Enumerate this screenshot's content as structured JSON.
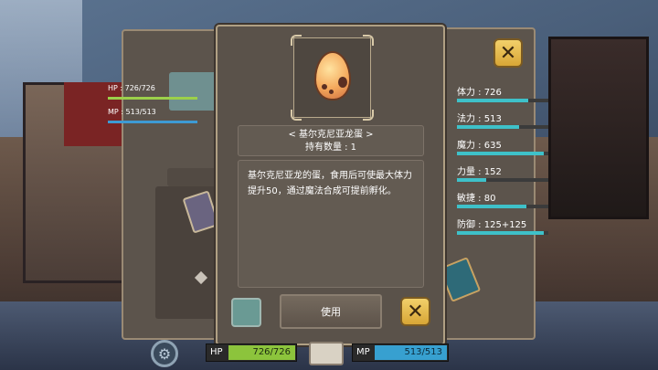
{
  "status": {
    "hp_label": "HP : 726/726",
    "mp_label": "MP : 513/513"
  },
  "stats": [
    {
      "label": "体力 : 726",
      "level": 0.78
    },
    {
      "label": "法力 : 513",
      "level": 0.68
    },
    {
      "label": "魔力 : 635",
      "level": 0.95
    },
    {
      "label": "力量 : 152",
      "level": 0.32
    },
    {
      "label": "敏捷 : 80",
      "level": 0.76
    },
    {
      "label": "防御 : 125+125",
      "level": 0.95
    }
  ],
  "item": {
    "icon": "dragon-egg-icon",
    "name": "< 基尔克尼亚龙蛋 >",
    "owned": "持有数量 : 1",
    "description": "基尔克尼亚龙的蛋，食用后可使最大体力提升50，通过魔法合成可提前孵化。",
    "use_label": "使用"
  },
  "hud": {
    "hp_label": "HP",
    "hp_value": "726/726",
    "hp_fill": 1.0,
    "mp_label": "MP",
    "mp_value": "513/513",
    "mp_fill": 1.0
  },
  "colors": {
    "hp_bar": "#8cc43c",
    "mp_bar": "#37a0d0",
    "stat_bar": "#3ec1c9",
    "close_button": "#e8bc4a"
  }
}
